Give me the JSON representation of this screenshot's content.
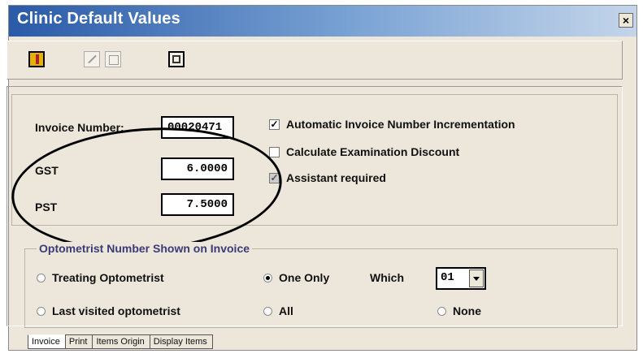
{
  "window": {
    "title": "Clinic Default Values",
    "close_label": "×"
  },
  "toolbar": {
    "buttons": [
      "exit-icon",
      "edit-icon",
      "copy-icon",
      "save-icon"
    ]
  },
  "invoice": {
    "number_label": "Invoice Number:",
    "number_value": "00020471",
    "gst_label": "GST",
    "gst_value": "6.0000",
    "pst_label": "PST",
    "pst_value": "7.5000"
  },
  "options": [
    {
      "label": "Automatic Invoice Number Incrementation",
      "checked": true
    },
    {
      "label": "Calculate Examination Discount",
      "checked": false
    },
    {
      "label": "Assistant required",
      "checked": true
    }
  ],
  "optometrist": {
    "legend": "Optometrist Number Shown on Invoice",
    "treating_label": "Treating Optometrist",
    "last_visited_label": "Last visited optometrist",
    "one_only_label": "One Only",
    "all_label": "All",
    "which_label": "Which",
    "which_value": "01",
    "none_label": "None",
    "selected": "One Only"
  },
  "tabs": [
    "Invoice",
    "Print",
    "Items Origin",
    "Display Items"
  ],
  "active_tab": "Invoice"
}
